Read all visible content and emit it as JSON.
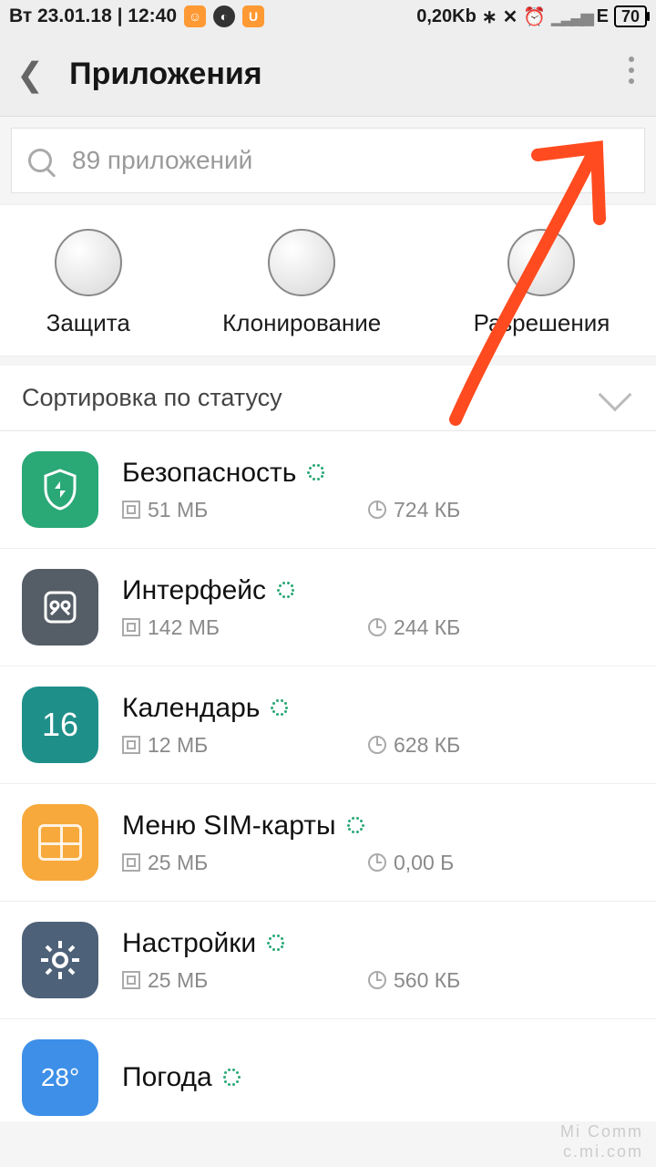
{
  "status": {
    "date_time": "Вт 23.01.18 | 12:40",
    "data_rate": "0,20Kb",
    "net_type": "E",
    "battery": "70"
  },
  "header": {
    "title": "Приложения"
  },
  "search": {
    "placeholder": "89 приложений"
  },
  "quick": {
    "items": [
      {
        "label": "Защита"
      },
      {
        "label": "Клонирование"
      },
      {
        "label": "Разрешения"
      }
    ]
  },
  "sort": {
    "label": "Сортировка по статусу"
  },
  "apps": [
    {
      "name": "Безопасность",
      "storage": "51 МБ",
      "cache": "724 КБ",
      "icon": "security"
    },
    {
      "name": "Интерфейс",
      "storage": "142 МБ",
      "cache": "244 КБ",
      "icon": "interface"
    },
    {
      "name": "Календарь",
      "storage": "12 МБ",
      "cache": "628 КБ",
      "icon": "calendar"
    },
    {
      "name": "Меню SIM-карты",
      "storage": "25 МБ",
      "cache": "0,00 Б",
      "icon": "sim"
    },
    {
      "name": "Настройки",
      "storage": "25 МБ",
      "cache": "560 КБ",
      "icon": "settings"
    },
    {
      "name": "Погода",
      "storage": "",
      "cache": "",
      "icon": "weather"
    }
  ],
  "watermark": {
    "line1": "Mi Comm",
    "line2": "c.mi.com"
  },
  "annotation": {
    "color": "#ff4b1f"
  }
}
